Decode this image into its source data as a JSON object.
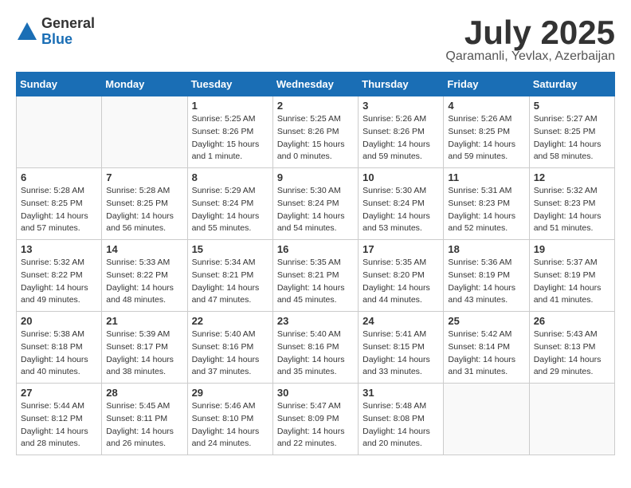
{
  "logo": {
    "general": "General",
    "blue": "Blue"
  },
  "title": "July 2025",
  "location": "Qaramanli, Yevlax, Azerbaijan",
  "days_of_week": [
    "Sunday",
    "Monday",
    "Tuesday",
    "Wednesday",
    "Thursday",
    "Friday",
    "Saturday"
  ],
  "weeks": [
    [
      {
        "day": "",
        "sunrise": "",
        "sunset": "",
        "daylight": ""
      },
      {
        "day": "",
        "sunrise": "",
        "sunset": "",
        "daylight": ""
      },
      {
        "day": "1",
        "sunrise": "Sunrise: 5:25 AM",
        "sunset": "Sunset: 8:26 PM",
        "daylight": "Daylight: 15 hours and 1 minute."
      },
      {
        "day": "2",
        "sunrise": "Sunrise: 5:25 AM",
        "sunset": "Sunset: 8:26 PM",
        "daylight": "Daylight: 15 hours and 0 minutes."
      },
      {
        "day": "3",
        "sunrise": "Sunrise: 5:26 AM",
        "sunset": "Sunset: 8:26 PM",
        "daylight": "Daylight: 14 hours and 59 minutes."
      },
      {
        "day": "4",
        "sunrise": "Sunrise: 5:26 AM",
        "sunset": "Sunset: 8:25 PM",
        "daylight": "Daylight: 14 hours and 59 minutes."
      },
      {
        "day": "5",
        "sunrise": "Sunrise: 5:27 AM",
        "sunset": "Sunset: 8:25 PM",
        "daylight": "Daylight: 14 hours and 58 minutes."
      }
    ],
    [
      {
        "day": "6",
        "sunrise": "Sunrise: 5:28 AM",
        "sunset": "Sunset: 8:25 PM",
        "daylight": "Daylight: 14 hours and 57 minutes."
      },
      {
        "day": "7",
        "sunrise": "Sunrise: 5:28 AM",
        "sunset": "Sunset: 8:25 PM",
        "daylight": "Daylight: 14 hours and 56 minutes."
      },
      {
        "day": "8",
        "sunrise": "Sunrise: 5:29 AM",
        "sunset": "Sunset: 8:24 PM",
        "daylight": "Daylight: 14 hours and 55 minutes."
      },
      {
        "day": "9",
        "sunrise": "Sunrise: 5:30 AM",
        "sunset": "Sunset: 8:24 PM",
        "daylight": "Daylight: 14 hours and 54 minutes."
      },
      {
        "day": "10",
        "sunrise": "Sunrise: 5:30 AM",
        "sunset": "Sunset: 8:24 PM",
        "daylight": "Daylight: 14 hours and 53 minutes."
      },
      {
        "day": "11",
        "sunrise": "Sunrise: 5:31 AM",
        "sunset": "Sunset: 8:23 PM",
        "daylight": "Daylight: 14 hours and 52 minutes."
      },
      {
        "day": "12",
        "sunrise": "Sunrise: 5:32 AM",
        "sunset": "Sunset: 8:23 PM",
        "daylight": "Daylight: 14 hours and 51 minutes."
      }
    ],
    [
      {
        "day": "13",
        "sunrise": "Sunrise: 5:32 AM",
        "sunset": "Sunset: 8:22 PM",
        "daylight": "Daylight: 14 hours and 49 minutes."
      },
      {
        "day": "14",
        "sunrise": "Sunrise: 5:33 AM",
        "sunset": "Sunset: 8:22 PM",
        "daylight": "Daylight: 14 hours and 48 minutes."
      },
      {
        "day": "15",
        "sunrise": "Sunrise: 5:34 AM",
        "sunset": "Sunset: 8:21 PM",
        "daylight": "Daylight: 14 hours and 47 minutes."
      },
      {
        "day": "16",
        "sunrise": "Sunrise: 5:35 AM",
        "sunset": "Sunset: 8:21 PM",
        "daylight": "Daylight: 14 hours and 45 minutes."
      },
      {
        "day": "17",
        "sunrise": "Sunrise: 5:35 AM",
        "sunset": "Sunset: 8:20 PM",
        "daylight": "Daylight: 14 hours and 44 minutes."
      },
      {
        "day": "18",
        "sunrise": "Sunrise: 5:36 AM",
        "sunset": "Sunset: 8:19 PM",
        "daylight": "Daylight: 14 hours and 43 minutes."
      },
      {
        "day": "19",
        "sunrise": "Sunrise: 5:37 AM",
        "sunset": "Sunset: 8:19 PM",
        "daylight": "Daylight: 14 hours and 41 minutes."
      }
    ],
    [
      {
        "day": "20",
        "sunrise": "Sunrise: 5:38 AM",
        "sunset": "Sunset: 8:18 PM",
        "daylight": "Daylight: 14 hours and 40 minutes."
      },
      {
        "day": "21",
        "sunrise": "Sunrise: 5:39 AM",
        "sunset": "Sunset: 8:17 PM",
        "daylight": "Daylight: 14 hours and 38 minutes."
      },
      {
        "day": "22",
        "sunrise": "Sunrise: 5:40 AM",
        "sunset": "Sunset: 8:16 PM",
        "daylight": "Daylight: 14 hours and 37 minutes."
      },
      {
        "day": "23",
        "sunrise": "Sunrise: 5:40 AM",
        "sunset": "Sunset: 8:16 PM",
        "daylight": "Daylight: 14 hours and 35 minutes."
      },
      {
        "day": "24",
        "sunrise": "Sunrise: 5:41 AM",
        "sunset": "Sunset: 8:15 PM",
        "daylight": "Daylight: 14 hours and 33 minutes."
      },
      {
        "day": "25",
        "sunrise": "Sunrise: 5:42 AM",
        "sunset": "Sunset: 8:14 PM",
        "daylight": "Daylight: 14 hours and 31 minutes."
      },
      {
        "day": "26",
        "sunrise": "Sunrise: 5:43 AM",
        "sunset": "Sunset: 8:13 PM",
        "daylight": "Daylight: 14 hours and 29 minutes."
      }
    ],
    [
      {
        "day": "27",
        "sunrise": "Sunrise: 5:44 AM",
        "sunset": "Sunset: 8:12 PM",
        "daylight": "Daylight: 14 hours and 28 minutes."
      },
      {
        "day": "28",
        "sunrise": "Sunrise: 5:45 AM",
        "sunset": "Sunset: 8:11 PM",
        "daylight": "Daylight: 14 hours and 26 minutes."
      },
      {
        "day": "29",
        "sunrise": "Sunrise: 5:46 AM",
        "sunset": "Sunset: 8:10 PM",
        "daylight": "Daylight: 14 hours and 24 minutes."
      },
      {
        "day": "30",
        "sunrise": "Sunrise: 5:47 AM",
        "sunset": "Sunset: 8:09 PM",
        "daylight": "Daylight: 14 hours and 22 minutes."
      },
      {
        "day": "31",
        "sunrise": "Sunrise: 5:48 AM",
        "sunset": "Sunset: 8:08 PM",
        "daylight": "Daylight: 14 hours and 20 minutes."
      },
      {
        "day": "",
        "sunrise": "",
        "sunset": "",
        "daylight": ""
      },
      {
        "day": "",
        "sunrise": "",
        "sunset": "",
        "daylight": ""
      }
    ]
  ]
}
